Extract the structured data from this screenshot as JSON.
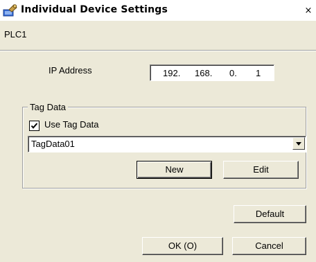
{
  "window": {
    "title": "Individual Device Settings",
    "close_glyph": "×",
    "title_icon": "settings-wrench-icon"
  },
  "device": {
    "name": "PLC1"
  },
  "ip": {
    "label": "IP Address",
    "octets": [
      "192.",
      "168.",
      "0.",
      "1"
    ]
  },
  "tag_group": {
    "title": "Tag Data",
    "use_tag_data_label": "Use Tag Data",
    "use_tag_data_checked": true,
    "selected_tag": "TagData01",
    "new_label": "New",
    "edit_label": "Edit"
  },
  "buttons": {
    "default_label": "Default",
    "ok_label": "OK (O)",
    "cancel_label": "Cancel"
  },
  "colors": {
    "dialog_bg": "#ece9d8",
    "titlebar_bg": "#ffffff"
  }
}
